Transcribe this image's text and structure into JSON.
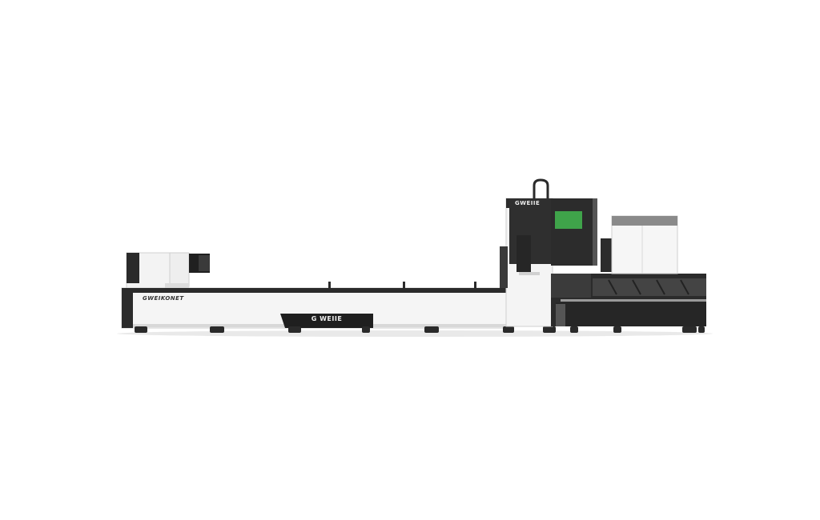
{
  "product": {
    "bed_brand_text": "GWEIKONET",
    "plate_text": "G WEIIE",
    "head_brand_text": "GWEIIE"
  },
  "colors": {
    "background": "#ffffff",
    "body_white": "#f4f4f4",
    "body_dark": "#2b2b2b",
    "window_green": "#3fa34a"
  }
}
